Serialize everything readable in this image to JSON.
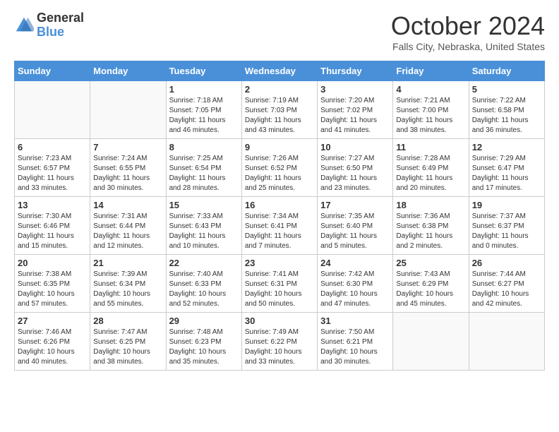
{
  "logo": {
    "general": "General",
    "blue": "Blue"
  },
  "title": "October 2024",
  "subtitle": "Falls City, Nebraska, United States",
  "days_of_week": [
    "Sunday",
    "Monday",
    "Tuesday",
    "Wednesday",
    "Thursday",
    "Friday",
    "Saturday"
  ],
  "weeks": [
    [
      {
        "day": "",
        "info": ""
      },
      {
        "day": "",
        "info": ""
      },
      {
        "day": "1",
        "info": "Sunrise: 7:18 AM\nSunset: 7:05 PM\nDaylight: 11 hours and 46 minutes."
      },
      {
        "day": "2",
        "info": "Sunrise: 7:19 AM\nSunset: 7:03 PM\nDaylight: 11 hours and 43 minutes."
      },
      {
        "day": "3",
        "info": "Sunrise: 7:20 AM\nSunset: 7:02 PM\nDaylight: 11 hours and 41 minutes."
      },
      {
        "day": "4",
        "info": "Sunrise: 7:21 AM\nSunset: 7:00 PM\nDaylight: 11 hours and 38 minutes."
      },
      {
        "day": "5",
        "info": "Sunrise: 7:22 AM\nSunset: 6:58 PM\nDaylight: 11 hours and 36 minutes."
      }
    ],
    [
      {
        "day": "6",
        "info": "Sunrise: 7:23 AM\nSunset: 6:57 PM\nDaylight: 11 hours and 33 minutes."
      },
      {
        "day": "7",
        "info": "Sunrise: 7:24 AM\nSunset: 6:55 PM\nDaylight: 11 hours and 30 minutes."
      },
      {
        "day": "8",
        "info": "Sunrise: 7:25 AM\nSunset: 6:54 PM\nDaylight: 11 hours and 28 minutes."
      },
      {
        "day": "9",
        "info": "Sunrise: 7:26 AM\nSunset: 6:52 PM\nDaylight: 11 hours and 25 minutes."
      },
      {
        "day": "10",
        "info": "Sunrise: 7:27 AM\nSunset: 6:50 PM\nDaylight: 11 hours and 23 minutes."
      },
      {
        "day": "11",
        "info": "Sunrise: 7:28 AM\nSunset: 6:49 PM\nDaylight: 11 hours and 20 minutes."
      },
      {
        "day": "12",
        "info": "Sunrise: 7:29 AM\nSunset: 6:47 PM\nDaylight: 11 hours and 17 minutes."
      }
    ],
    [
      {
        "day": "13",
        "info": "Sunrise: 7:30 AM\nSunset: 6:46 PM\nDaylight: 11 hours and 15 minutes."
      },
      {
        "day": "14",
        "info": "Sunrise: 7:31 AM\nSunset: 6:44 PM\nDaylight: 11 hours and 12 minutes."
      },
      {
        "day": "15",
        "info": "Sunrise: 7:33 AM\nSunset: 6:43 PM\nDaylight: 11 hours and 10 minutes."
      },
      {
        "day": "16",
        "info": "Sunrise: 7:34 AM\nSunset: 6:41 PM\nDaylight: 11 hours and 7 minutes."
      },
      {
        "day": "17",
        "info": "Sunrise: 7:35 AM\nSunset: 6:40 PM\nDaylight: 11 hours and 5 minutes."
      },
      {
        "day": "18",
        "info": "Sunrise: 7:36 AM\nSunset: 6:38 PM\nDaylight: 11 hours and 2 minutes."
      },
      {
        "day": "19",
        "info": "Sunrise: 7:37 AM\nSunset: 6:37 PM\nDaylight: 11 hours and 0 minutes."
      }
    ],
    [
      {
        "day": "20",
        "info": "Sunrise: 7:38 AM\nSunset: 6:35 PM\nDaylight: 10 hours and 57 minutes."
      },
      {
        "day": "21",
        "info": "Sunrise: 7:39 AM\nSunset: 6:34 PM\nDaylight: 10 hours and 55 minutes."
      },
      {
        "day": "22",
        "info": "Sunrise: 7:40 AM\nSunset: 6:33 PM\nDaylight: 10 hours and 52 minutes."
      },
      {
        "day": "23",
        "info": "Sunrise: 7:41 AM\nSunset: 6:31 PM\nDaylight: 10 hours and 50 minutes."
      },
      {
        "day": "24",
        "info": "Sunrise: 7:42 AM\nSunset: 6:30 PM\nDaylight: 10 hours and 47 minutes."
      },
      {
        "day": "25",
        "info": "Sunrise: 7:43 AM\nSunset: 6:29 PM\nDaylight: 10 hours and 45 minutes."
      },
      {
        "day": "26",
        "info": "Sunrise: 7:44 AM\nSunset: 6:27 PM\nDaylight: 10 hours and 42 minutes."
      }
    ],
    [
      {
        "day": "27",
        "info": "Sunrise: 7:46 AM\nSunset: 6:26 PM\nDaylight: 10 hours and 40 minutes."
      },
      {
        "day": "28",
        "info": "Sunrise: 7:47 AM\nSunset: 6:25 PM\nDaylight: 10 hours and 38 minutes."
      },
      {
        "day": "29",
        "info": "Sunrise: 7:48 AM\nSunset: 6:23 PM\nDaylight: 10 hours and 35 minutes."
      },
      {
        "day": "30",
        "info": "Sunrise: 7:49 AM\nSunset: 6:22 PM\nDaylight: 10 hours and 33 minutes."
      },
      {
        "day": "31",
        "info": "Sunrise: 7:50 AM\nSunset: 6:21 PM\nDaylight: 10 hours and 30 minutes."
      },
      {
        "day": "",
        "info": ""
      },
      {
        "day": "",
        "info": ""
      }
    ]
  ]
}
